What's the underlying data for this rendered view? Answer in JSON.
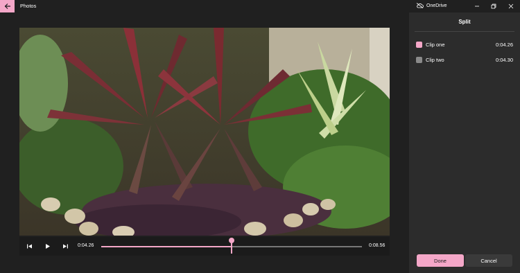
{
  "window": {
    "app_title": "Photos",
    "onedrive_label": "OneDrive",
    "accent_color": "#f4a7c8"
  },
  "icons": {
    "back": "arrow-left-icon",
    "onedrive": "cloud-off-icon",
    "minimize": "minimize-icon",
    "restore": "restore-icon",
    "close": "close-icon",
    "prev_frame": "skip-back-icon",
    "play": "play-icon",
    "next_frame": "skip-forward-icon"
  },
  "player": {
    "start_time": "0:04.26",
    "end_time": "0:08.56",
    "split_position_fraction": 0.5
  },
  "split_panel": {
    "title": "Split",
    "clips": [
      {
        "name": "Clip one",
        "duration": "0:04.26",
        "color": "#f4a7c8"
      },
      {
        "name": "Clip two",
        "duration": "0:04.30",
        "color": "#8a8a8a"
      }
    ],
    "done_label": "Done",
    "cancel_label": "Cancel"
  }
}
